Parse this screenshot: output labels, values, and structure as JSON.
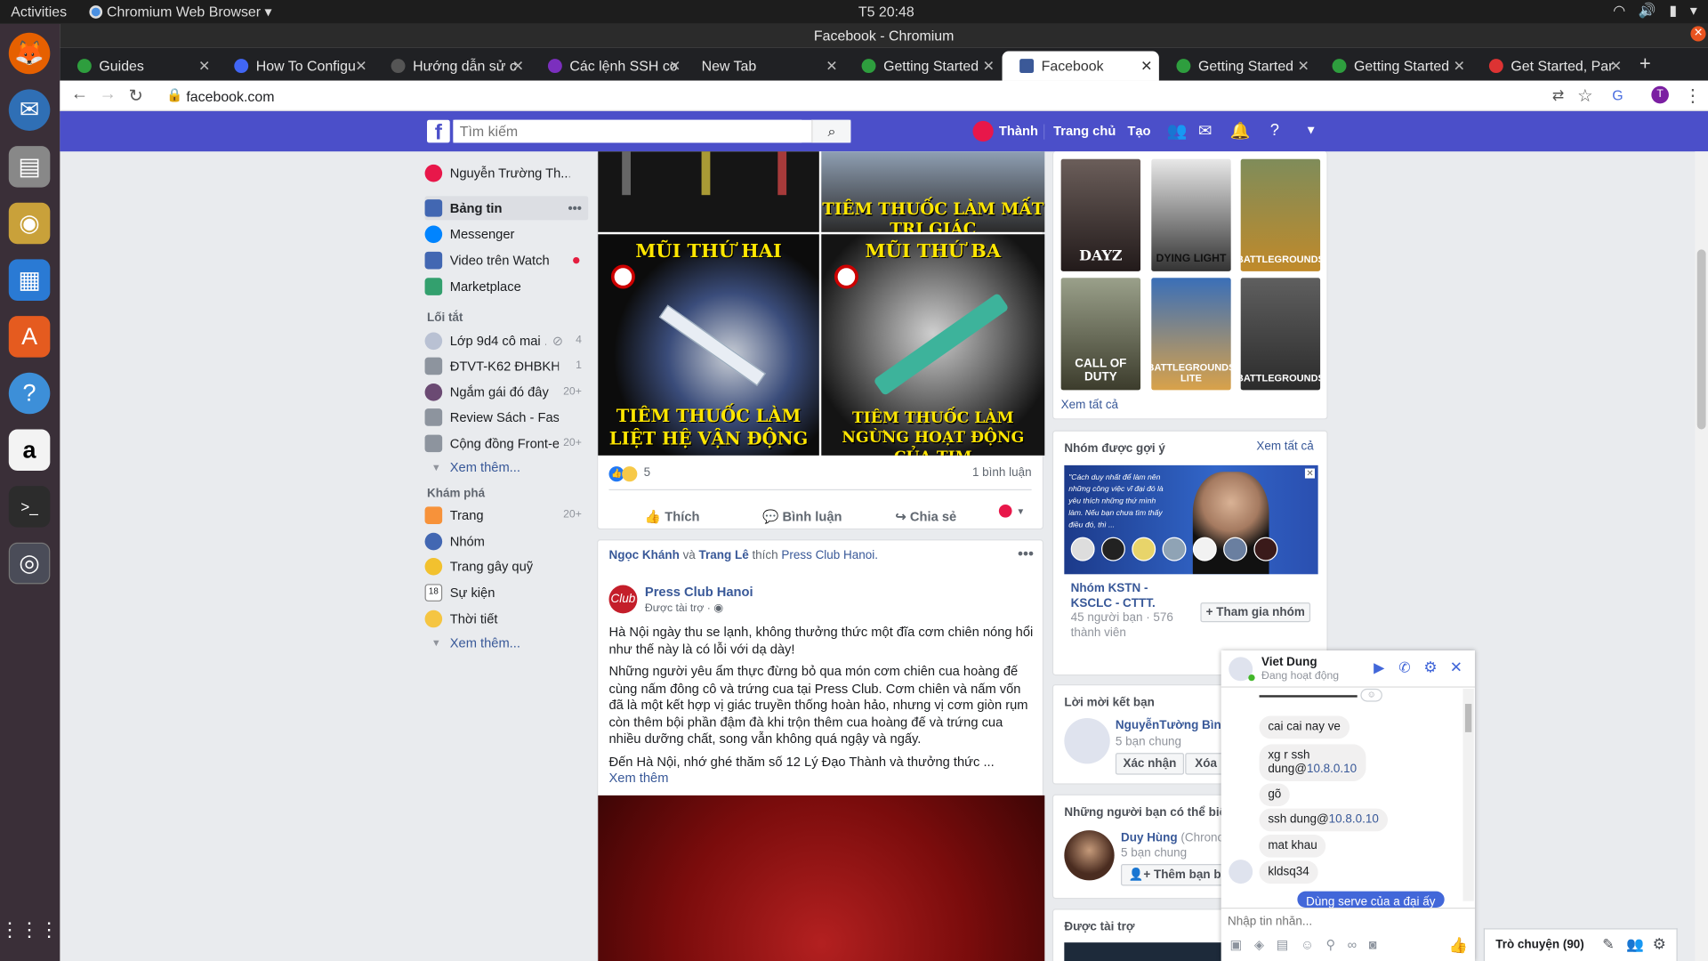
{
  "os": {
    "activities": "Activities",
    "app_menu": "Chromium Web Browser ▾",
    "clock": "T5 20:48"
  },
  "window": {
    "title": "Facebook - Chromium"
  },
  "tabs": [
    {
      "label": "Guides",
      "color": "#2e9e3e"
    },
    {
      "label": "How To Configu",
      "color": "#4166f5"
    },
    {
      "label": "Hướng dẫn sử c",
      "color": "#555"
    },
    {
      "label": "Các lệnh SSH co",
      "color": "#7b2fbe"
    },
    {
      "label": "New Tab",
      "color": ""
    },
    {
      "label": "Getting Started",
      "color": "#2e9e3e"
    },
    {
      "label": "Facebook",
      "color": "#3b5998"
    },
    {
      "label": "Getting Started",
      "color": "#2e9e3e"
    },
    {
      "label": "Getting Started",
      "color": "#2e9e3e"
    },
    {
      "label": "Get Started, Par",
      "color": "#d33"
    }
  ],
  "address": {
    "url": "facebook.com"
  },
  "header": {
    "logo": "f",
    "search_placeholder": "Tìm kiếm",
    "user": "Thành",
    "home": "Trang chủ",
    "create": "Tạo"
  },
  "left_nav": {
    "profile": "Nguyễn Trường Th...",
    "main": [
      {
        "label": "Bảng tin",
        "more": "•••"
      },
      {
        "label": "Messenger"
      },
      {
        "label": "Video trên Watch"
      },
      {
        "label": "Marketplace"
      }
    ],
    "shortcuts_title": "Lối tắt",
    "shortcuts": [
      {
        "label": "Lớp 9d4 cô mai ...",
        "count": "4"
      },
      {
        "label": "ĐTVT-K62 ĐHBKH...",
        "count": "1"
      },
      {
        "label": "Ngắm gái đó đây",
        "count": "20+"
      },
      {
        "label": "Review Sách - Fast...",
        "count": ""
      },
      {
        "label": "Cộng đồng Front-e...",
        "count": "20+"
      }
    ],
    "see_more": "Xem thêm...",
    "explore_title": "Khám phá",
    "explore": [
      {
        "label": "Trang",
        "count": "20+"
      },
      {
        "label": "Nhóm",
        "count": ""
      },
      {
        "label": "Trang gây quỹ",
        "count": ""
      },
      {
        "label": "Sự kiện",
        "count": ""
      },
      {
        "label": "Thời tiết",
        "count": ""
      }
    ],
    "see_more2": "Xem thêm..."
  },
  "post1": {
    "captions": [
      "TIÊM THUỐC LÀM MẤT TRI GIÁC",
      "MŨI THỨ HAI",
      "MŨI THỨ BA",
      "TIÊM THUỐC LÀM LIỆT HỆ VẬN ĐỘNG",
      "TIÊM THUỐC LÀM NGỪNG HOẠT ĐỘNG CỦA TIM"
    ],
    "reactions": "5",
    "comments": "1 bình luận",
    "like": "Thích",
    "comment": "Bình luận",
    "share": "Chia sẻ"
  },
  "post2": {
    "friend1": "Ngọc Khánh",
    "and": "và",
    "friend2": "Trang Lê",
    "liked": "thích",
    "page_link": "Press Club Hanoi.",
    "page": "Press Club Hanoi",
    "sponsored": "Được tài trợ · ◉",
    "p1": "Hà Nội ngày thu se lạnh, không thưởng thức một đĩa cơm chiên nóng hổi như thế này là có lỗi với dạ dày!",
    "p2": "Những người yêu ẩm thực đừng bỏ qua món cơm chiên cua hoàng đế cùng nấm đông cô và trứng cua tại Press Club. Cơm chiên và nấm vốn đã là một kết hợp vị giác truyền thống hoàn hảo, nhưng vị cơm giòn rụm còn thêm bội phần đậm đà khi trộn thêm cua hoàng đế và trứng cua nhiều dưỡng chất, song vẫn không quá ngậy và ngấy.",
    "p3": "Đến Hà Nội, nhớ ghé thăm số 12 Lý Đạo Thành và thưởng thức ...",
    "see_more": "Xem thêm"
  },
  "right": {
    "games": [
      "DAYZ",
      "DYING LIGHT",
      "BATTLEGROUNDS",
      "CALL OF DUTY",
      "BATTLEGROUNDS LITE",
      "BATTLEGROUNDS"
    ],
    "see_all": "Xem tất cả",
    "groups_title": "Nhóm được gợi ý",
    "groups_see_all": "Xem tất cả",
    "group_quote": "\"Cách duy nhất để làm nên những công việc vĩ đại đó là yêu thích những thứ mình làm. Nếu bạn chưa tìm thấy điều đó, thì ...",
    "group_name": "Nhóm KSTN - KSCLC - CTTT.",
    "group_meta": "45 người bạn · 576 thành viên",
    "join": "Tham gia nhóm",
    "requests_title": "Lời mời kết bạn",
    "req_name": "NguyễnTường Bình",
    "req_mutual": "5 bạn chung",
    "confirm": "Xác nhận",
    "delete": "Xóa",
    "pymk_title": "Những người bạn có thể biết",
    "pymk_name": "Duy Hùng",
    "pymk_extra": "(Chrono",
    "pymk_mutual": "5 bạn chung",
    "add_friend": "Thêm bạn bè",
    "sponsored_title": "Được tài trợ"
  },
  "chat": {
    "name": "Viet Dung",
    "status": "Đang hoạt động",
    "messages": [
      {
        "text": "cai cai nay ve"
      },
      {
        "text": "xg r ssh",
        "text2": "dung@",
        "ip": "10.8.0.10"
      },
      {
        "text": "gõ"
      },
      {
        "text": "ssh dung@",
        "ip": "10.8.0.10"
      },
      {
        "text": "mat khau"
      },
      {
        "text": "kldsq34"
      }
    ],
    "outgoing": "Dùng serve của a đại ấy",
    "input_placeholder": "Nhập tin nhắn...",
    "sidebar_label": "Trò chuyện (90)"
  },
  "colors": {
    "fb_blue": "#4b4fc9",
    "link": "#385898",
    "dock": "#3a2f38"
  }
}
